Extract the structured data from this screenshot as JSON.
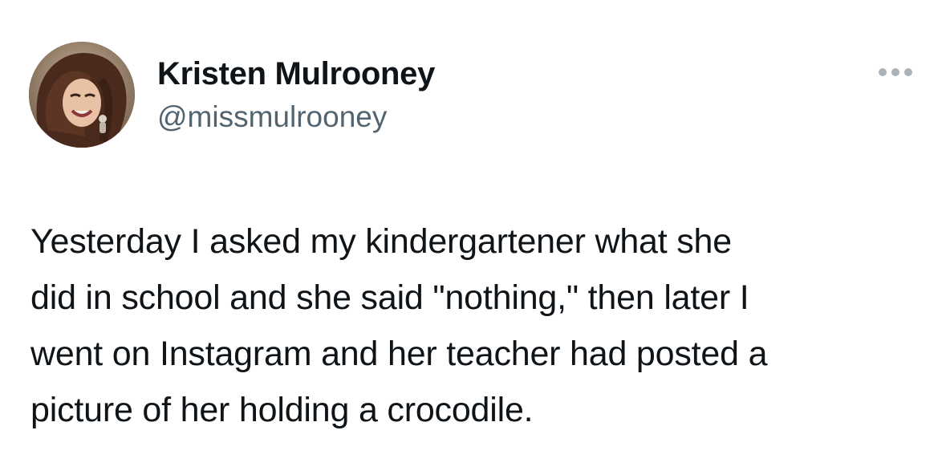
{
  "author": {
    "display_name": "Kristen Mulrooney",
    "handle": "@missmulrooney",
    "avatar_icon": "user-photo"
  },
  "menu": {
    "icon": "more-options-icon"
  },
  "tweet": {
    "lines": [
      "Yesterday I asked my kindergartener what she",
      "did in school and she said \"nothing,\" then later I",
      "went on Instagram and her teacher had posted a",
      "picture of her holding a crocodile."
    ]
  },
  "colors": {
    "text_primary": "#0f1419",
    "text_secondary": "#536471",
    "background": "#ffffff"
  }
}
